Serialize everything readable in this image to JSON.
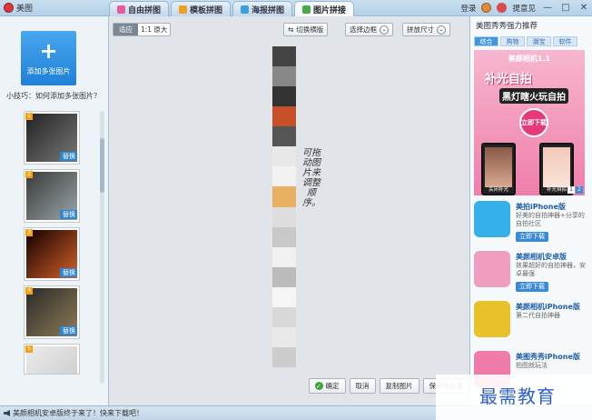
{
  "window": {
    "title": "美图",
    "login": "登录",
    "feedback": "提意见",
    "controls": [
      "—",
      "□",
      "✕"
    ]
  },
  "tabs": [
    {
      "label": "自由拼图",
      "color": "#e85a9b"
    },
    {
      "label": "模板拼图",
      "color": "#f0a020"
    },
    {
      "label": "海报拼图",
      "color": "#3aa0e0"
    },
    {
      "label": "图片拼接",
      "color": "#4aa84a",
      "active": true
    }
  ],
  "left": {
    "add_label": "添加多张图片",
    "tip": "小技巧：如何添加多张图片？",
    "replace_label": "替换",
    "thumbs": [
      {
        "n": "1",
        "colors": [
          "#222",
          "#777"
        ]
      },
      {
        "n": "2",
        "colors": [
          "#3a3a3a",
          "#9aa5a8"
        ]
      },
      {
        "n": "3",
        "colors": [
          "#100",
          "#d46028"
        ]
      },
      {
        "n": "4",
        "colors": [
          "#2b2b28",
          "#8c7a58"
        ]
      },
      {
        "n": "5",
        "colors": [
          "#ececec",
          "#c8c8c8"
        ]
      }
    ]
  },
  "toolbar": {
    "fit": "适应",
    "actual": "1:1 原大",
    "switch": "切换横版",
    "border": "选择边框",
    "size": "拼放尺寸"
  },
  "canvas": {
    "note": "可拖动图片来调整顺序。",
    "strip": [
      "#444",
      "#888",
      "#333",
      "#c85028",
      "#555",
      "#e8e8e8",
      "#f2f2f2",
      "#e8b060",
      "#ddd",
      "#c8c8c8",
      "#f0f0f0",
      "#bbb",
      "#f5f5f5",
      "#d8d8d8",
      "#e9e9e9",
      "#ccc"
    ]
  },
  "bottom": {
    "ok": "确定",
    "cancel": "取消",
    "copy": "复制图片",
    "save": "保存与分享"
  },
  "right": {
    "title": "美图秀秀强力推荐",
    "tabs": [
      "综合",
      "购物",
      "潮宝",
      "软件"
    ],
    "banner": {
      "head": "美颜相机1.1",
      "line1": "补光自拍",
      "line2": "黑灯瞎火玩自拍",
      "cta": "立即下载",
      "left_cap": "关闭补光",
      "right_cap": "补光自拍",
      "pages": [
        "1",
        "2"
      ]
    },
    "apps": [
      {
        "name": "美拍iPhone版",
        "desc": "好美的自拍神器+分享的自拍社区",
        "dl": "立即下载",
        "color": "#35b0e8"
      },
      {
        "name": "美颜相机安卓版",
        "desc": "效果超好的自拍神器，安卓最强",
        "dl": "立即下载",
        "color": "#f09ec0"
      },
      {
        "name": "美颜相机iPhone版",
        "desc": "第二代自拍神器",
        "dl": "",
        "color": "#e9c12a"
      },
      {
        "name": "美图秀秀iPhone版",
        "desc": "拍图就玩法",
        "dl": "",
        "color": "#f07aa8"
      }
    ]
  },
  "status": "美颜相机安卓版终于来了！快来下载吧！",
  "watermark": "最需教育"
}
